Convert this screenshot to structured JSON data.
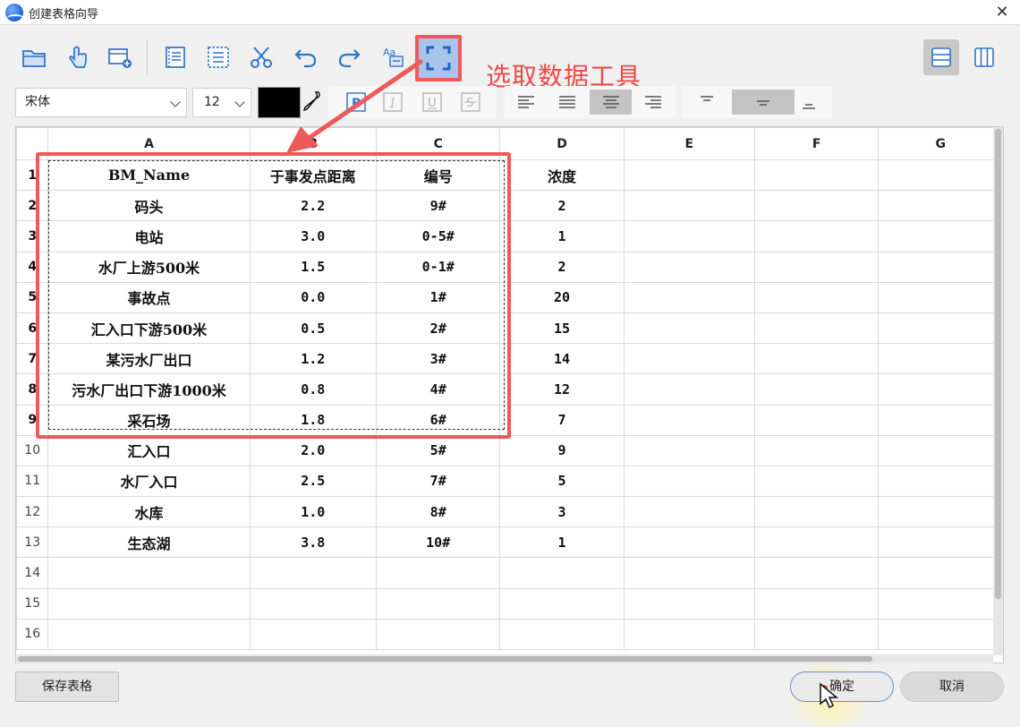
{
  "window": {
    "title": "创建表格向导",
    "close_label": "✕"
  },
  "toolbar": {
    "tools": [
      "open-folder",
      "pointer-hand",
      "insert-table",
      "cut-left",
      "cut-table",
      "scissors",
      "undo",
      "redo",
      "text-format",
      "select-data"
    ]
  },
  "annotation": {
    "label": "选取数据工具",
    "color": "#ee4848"
  },
  "format": {
    "font_family": "宋体",
    "font_size": "12",
    "text_color": "#000000"
  },
  "sheet": {
    "columns": [
      "A",
      "B",
      "C",
      "D",
      "E",
      "F",
      "G"
    ],
    "rows": [
      {
        "n": "1",
        "cells": [
          "BM_Name",
          "于事发点距离",
          "编号",
          "浓度"
        ]
      },
      {
        "n": "2",
        "cells": [
          "码头",
          "2.2",
          "9#",
          "2"
        ]
      },
      {
        "n": "3",
        "cells": [
          "电站",
          "3.0",
          "0-5#",
          "1"
        ]
      },
      {
        "n": "4",
        "cells": [
          "水厂上游500米",
          "1.5",
          "0-1#",
          "2"
        ]
      },
      {
        "n": "5",
        "cells": [
          "事故点",
          "0.0",
          "1#",
          "20"
        ]
      },
      {
        "n": "6",
        "cells": [
          "汇入口下游500米",
          "0.5",
          "2#",
          "15"
        ]
      },
      {
        "n": "7",
        "cells": [
          "某污水厂出口",
          "1.2",
          "3#",
          "14"
        ]
      },
      {
        "n": "8",
        "cells": [
          "污水厂出口下游1000米",
          "0.8",
          "4#",
          "12"
        ]
      },
      {
        "n": "9",
        "cells": [
          "采石场",
          "1.8",
          "6#",
          "7"
        ]
      },
      {
        "n": "10",
        "cells": [
          "汇入口",
          "2.0",
          "5#",
          "9"
        ]
      },
      {
        "n": "11",
        "cells": [
          "水厂入口",
          "2.5",
          "7#",
          "5"
        ]
      },
      {
        "n": "12",
        "cells": [
          "水库",
          "1.0",
          "8#",
          "3"
        ]
      },
      {
        "n": "13",
        "cells": [
          "生态湖",
          "3.8",
          "10#",
          "1"
        ]
      },
      {
        "n": "14",
        "cells": [
          "",
          "",
          "",
          ""
        ]
      },
      {
        "n": "15",
        "cells": [
          "",
          "",
          "",
          ""
        ]
      },
      {
        "n": "16",
        "cells": [
          "",
          "",
          "",
          ""
        ]
      }
    ]
  },
  "buttons": {
    "save": "保存表格",
    "ok": "确定",
    "cancel": "取消"
  },
  "colors": {
    "accent": "#ee5a5a",
    "selected_tool_bg": "#a7c4ea",
    "icon_blue": "#2f73c9"
  }
}
